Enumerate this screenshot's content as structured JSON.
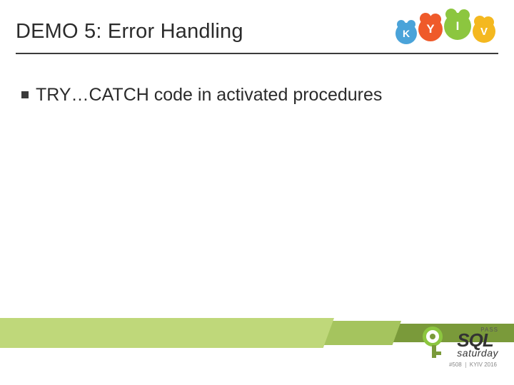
{
  "header": {
    "title": "DEMO 5: Error Handling",
    "logo_letters": [
      "K",
      "Y",
      "I",
      "V"
    ]
  },
  "content": {
    "bullets": [
      "TRY…CATCH code in activated procedures"
    ]
  },
  "footer": {
    "brand_small": "PASS",
    "brand_main": "SQL",
    "brand_sub": "saturday",
    "event_id": "#508",
    "event_label": "KYIV 2016"
  }
}
